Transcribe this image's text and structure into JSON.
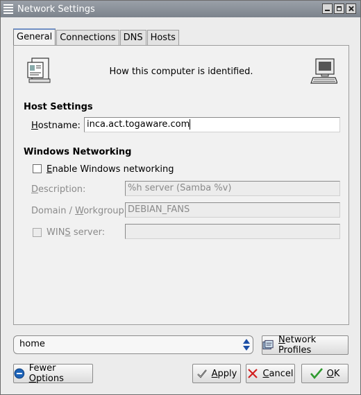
{
  "window": {
    "title": "Network Settings"
  },
  "tabs": [
    {
      "label": "General",
      "active": true
    },
    {
      "label": "Connections",
      "active": false
    },
    {
      "label": "DNS",
      "active": false
    },
    {
      "label": "Hosts",
      "active": false
    }
  ],
  "header": {
    "text": "How this computer is identified."
  },
  "host_settings": {
    "title": "Host Settings",
    "hostname_label_u": "H",
    "hostname_label_rest": "ostname:",
    "hostname_value": "inca.act.togaware.com"
  },
  "windows_networking": {
    "title": "Windows Networking",
    "enable_label_u": "E",
    "enable_label_rest": "nable Windows networking",
    "enable_checked": false,
    "description_label_u": "D",
    "description_label_rest": "escription:",
    "description_value": "%h server (Samba %v)",
    "domain_label_pre": "Domain / ",
    "domain_label_u": "W",
    "domain_label_rest": "orkgroup:",
    "domain_value": "DEBIAN_FANS",
    "wins_label_pre": "WIN",
    "wins_label_u": "S",
    "wins_label_rest": " server:",
    "wins_checked": false,
    "wins_value": ""
  },
  "profile": {
    "current": "home",
    "network_profiles_u": "N",
    "network_profiles_rest": "etwork Profiles"
  },
  "buttons": {
    "fewer_pre": "Fewer ",
    "fewer_u": "O",
    "fewer_rest": "ptions",
    "apply_u": "A",
    "apply_rest": "pply",
    "cancel_u": "C",
    "cancel_rest": "ancel",
    "ok_u": "O",
    "ok_rest": "K"
  },
  "colors": {
    "titlebar": "#8a9099",
    "accent": "#1d4fa6",
    "ok_green": "#2e9a2e",
    "cancel_red": "#d21f1f"
  }
}
